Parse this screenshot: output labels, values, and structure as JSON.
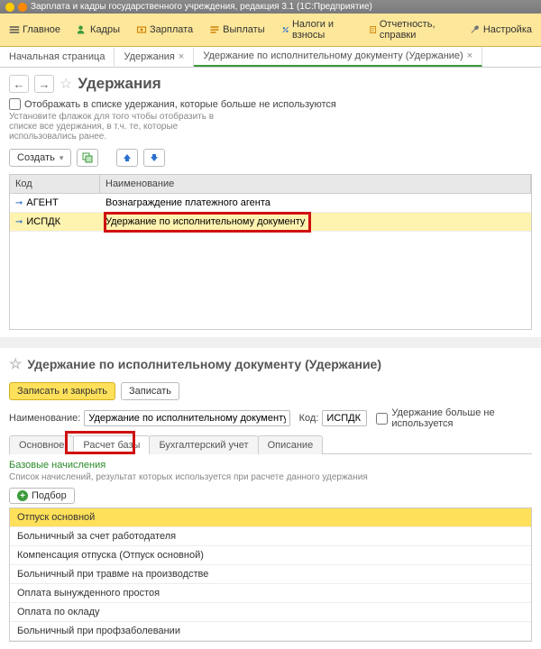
{
  "titlebar": {
    "text": "Зарплата и кадры государственного учреждения, редакция 3.1  (1С:Предприятие)"
  },
  "toolbar": {
    "items": [
      {
        "label": "Главное"
      },
      {
        "label": "Кадры"
      },
      {
        "label": "Зарплата"
      },
      {
        "label": "Выплаты"
      },
      {
        "label": "Налоги и взносы"
      },
      {
        "label": "Отчетность, справки"
      },
      {
        "label": "Настройка"
      }
    ]
  },
  "tabs": {
    "items": [
      {
        "label": "Начальная страница",
        "closable": false,
        "active": false
      },
      {
        "label": "Удержания",
        "closable": true,
        "active": false
      },
      {
        "label": "Удержание по исполнительному документу (Удержание)",
        "closable": true,
        "active": true
      }
    ]
  },
  "panel1": {
    "title": "Удержания",
    "checkbox_label": "Отображать в списке удержания, которые больше не используются",
    "hint": "Установите флажок для того чтобы отобразить в списке все удержания, в т.ч. те, которые использовались ранее.",
    "create_label": "Создать",
    "grid": {
      "head_code": "Код",
      "head_name": "Наименование",
      "rows": [
        {
          "code": "АГЕНТ",
          "name": "Вознаграждение платежного агента",
          "selected": false
        },
        {
          "code": "ИСПДК",
          "name": "Удержание по исполнительному документу",
          "selected": true
        }
      ]
    }
  },
  "panel2": {
    "title": "Удержание по исполнительному документу (Удержание)",
    "save_close_label": "Записать и закрыть",
    "save_label": "Записать",
    "name_label": "Наименование:",
    "name_value": "Удержание по исполнительному документу",
    "code_label": "Код:",
    "code_value": "ИСПДК",
    "unused_label": "Удержание больше не используется",
    "subtabs": [
      {
        "label": "Основное",
        "active": false
      },
      {
        "label": "Расчет базы",
        "active": true
      },
      {
        "label": "Бухгалтерский учет",
        "active": false
      },
      {
        "label": "Описание",
        "active": false
      }
    ],
    "section_title": "Базовые начисления",
    "section_hint": "Список начислений, результат которых используется при расчете данного удержания",
    "pick_label": "Подбор",
    "list": [
      {
        "label": "Отпуск основной",
        "hl": true
      },
      {
        "label": "Больничный за счет работодателя",
        "hl": false
      },
      {
        "label": "Компенсация отпуска (Отпуск основной)",
        "hl": false
      },
      {
        "label": "Больничный при травме на производстве",
        "hl": false
      },
      {
        "label": "Оплата вынужденного простоя",
        "hl": false
      },
      {
        "label": "Оплата по окладу",
        "hl": false
      },
      {
        "label": "Больничный при профзаболевании",
        "hl": false
      }
    ]
  }
}
